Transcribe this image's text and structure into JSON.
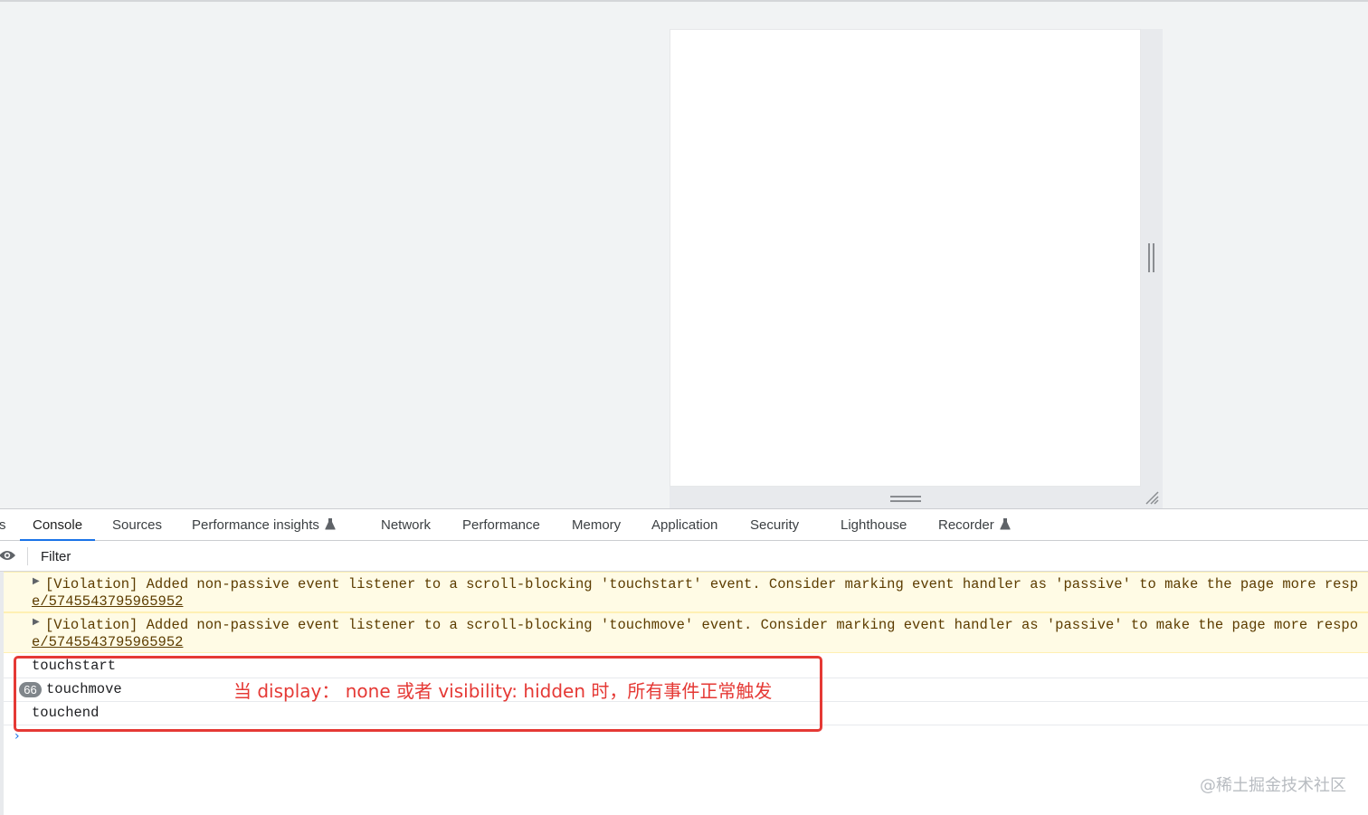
{
  "devtools": {
    "tabs": [
      {
        "label": "s"
      },
      {
        "label": "Console"
      },
      {
        "label": "Sources"
      },
      {
        "label": "Performance insights"
      },
      {
        "label": "Network"
      },
      {
        "label": "Performance"
      },
      {
        "label": "Memory"
      },
      {
        "label": "Application"
      },
      {
        "label": "Security"
      },
      {
        "label": "Lighthouse"
      },
      {
        "label": "Recorder"
      }
    ],
    "active_tab": "Console",
    "filter": {
      "placeholder": "Filter",
      "value": ""
    }
  },
  "console": {
    "violations": [
      {
        "text": "[Violation] Added non-passive event listener to a scroll-blocking 'touchstart' event. Consider marking event handler as 'passive' to make the page more resp",
        "link": "e/5745543795965952"
      },
      {
        "text": "[Violation] Added non-passive event listener to a scroll-blocking 'touchmove' event. Consider marking event handler as 'passive' to make the page more respo",
        "link": "e/5745543795965952"
      }
    ],
    "logs": [
      {
        "text": "touchstart",
        "count": ""
      },
      {
        "text": "touchmove",
        "count": "66"
      },
      {
        "text": "touchend",
        "count": ""
      }
    ]
  },
  "annotation": {
    "text": "当 display： none 或者 visibility: hidden 时，所有事件正常触发",
    "color": "#e53935"
  },
  "watermark": "@稀土掘金技术社区",
  "colors": {
    "accent": "#1a73e8",
    "violation_bg": "#fffbe5"
  }
}
